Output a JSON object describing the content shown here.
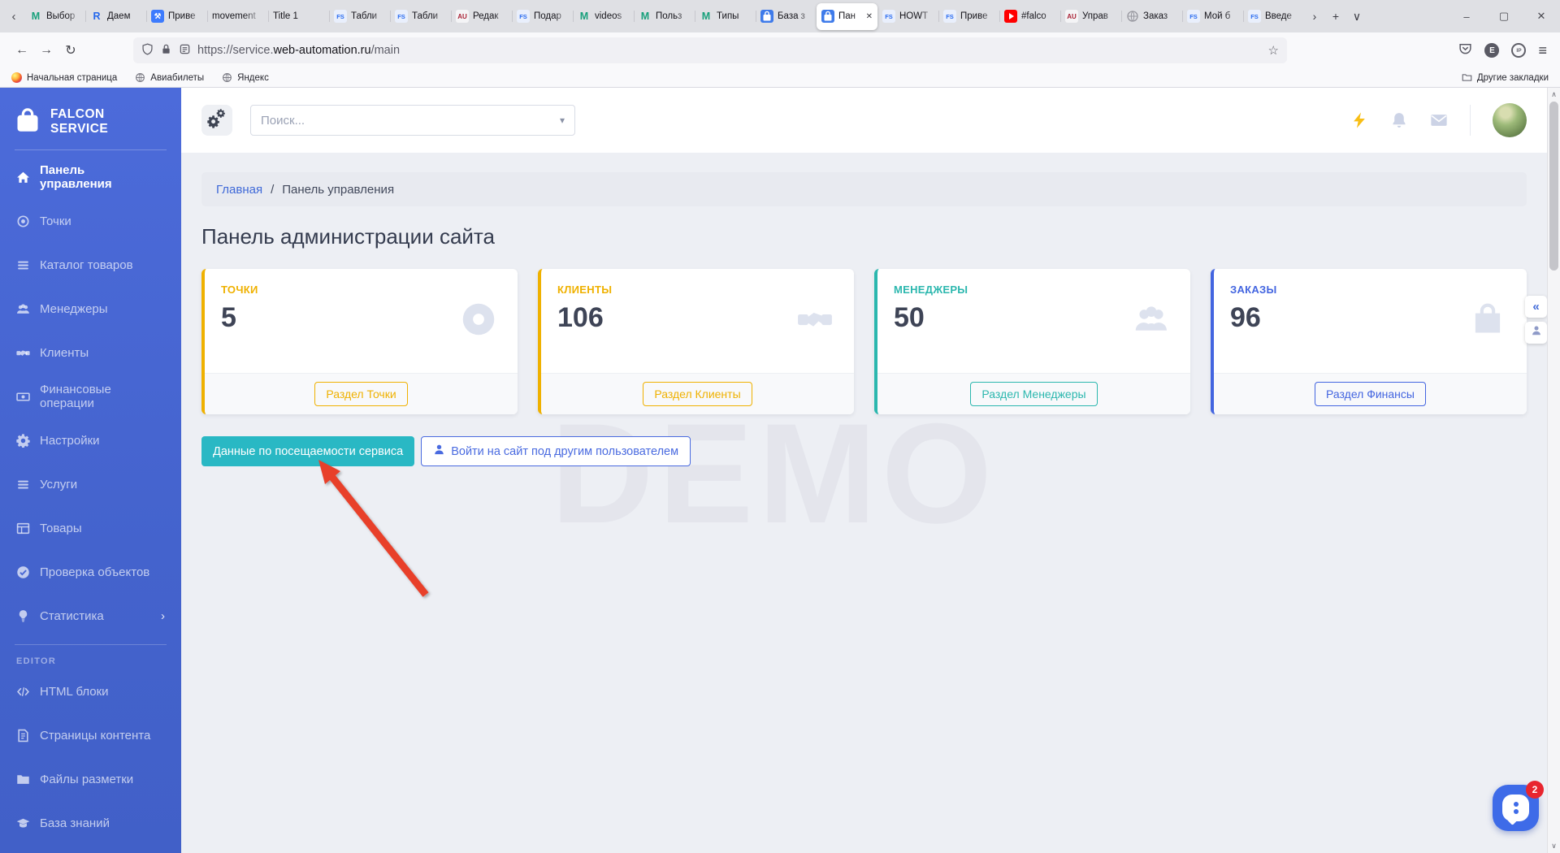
{
  "browser": {
    "tabs": [
      {
        "icon": "fav-m",
        "label": "Выбор"
      },
      {
        "icon": "fav-r",
        "label": "Даем"
      },
      {
        "icon": "fav-wrench",
        "label": "Приве"
      },
      {
        "icon": "",
        "label": "movement"
      },
      {
        "icon": "",
        "label": "Title 1"
      },
      {
        "icon": "fav-fs",
        "label": "Табли"
      },
      {
        "icon": "fav-fs",
        "label": "Табли"
      },
      {
        "icon": "fav-au",
        "label": "Редак"
      },
      {
        "icon": "fav-fs",
        "label": "Подар"
      },
      {
        "icon": "fav-m",
        "label": "videos"
      },
      {
        "icon": "fav-m",
        "label": "Польз"
      },
      {
        "icon": "fav-m",
        "label": "Типы"
      },
      {
        "icon": "fav-bag",
        "label": "База з"
      },
      {
        "icon": "fav-bag",
        "label": "Пан",
        "active": true
      },
      {
        "icon": "fav-fs",
        "label": "HOWT"
      },
      {
        "icon": "fav-fs",
        "label": "Приве"
      },
      {
        "icon": "fav-yt",
        "label": "#falco"
      },
      {
        "icon": "fav-au",
        "label": "Управ"
      },
      {
        "icon": "fav-globe",
        "label": "Заказ"
      },
      {
        "icon": "fav-fs",
        "label": "Мой б"
      },
      {
        "icon": "fav-fs",
        "label": "Введе"
      }
    ],
    "url": {
      "prefix": "https://service.",
      "domain": "web-automation.ru",
      "path": "/main"
    },
    "bookmarks": [
      {
        "icon": "firefox",
        "label": "Начальная страница"
      },
      {
        "icon": "globe",
        "label": "Авиабилеты"
      },
      {
        "icon": "globe",
        "label": "Яндекс"
      }
    ],
    "other_bookmarks": "Другие закладки",
    "extension_badge": "E",
    "ip_badge": "IP"
  },
  "glyphs": {
    "tab_scroll_left": "‹",
    "tab_overflow": "›",
    "new_tab": "+",
    "tabs_menu": "∨",
    "tab_close": "✕",
    "back": "←",
    "forward": "→",
    "reload": "↻",
    "bookmark_star": "☆",
    "menu": "≡",
    "minimize": "–",
    "maximize": "▢",
    "close": "✕",
    "caret_down": "▾",
    "collapse": "«",
    "scroll_up": "∧",
    "scroll_down": "∨"
  },
  "sidebar": {
    "brand": "FALCON SERVICE",
    "items": [
      {
        "icon": "home",
        "label": "Панель управления",
        "active": true
      },
      {
        "icon": "target",
        "label": "Точки"
      },
      {
        "icon": "list",
        "label": "Каталог товаров"
      },
      {
        "icon": "users",
        "label": "Менеджеры"
      },
      {
        "icon": "handshake",
        "label": "Клиенты"
      },
      {
        "icon": "cash",
        "label": "Финансовые операции"
      },
      {
        "icon": "gear",
        "label": "Настройки"
      },
      {
        "icon": "list",
        "label": "Услуги"
      },
      {
        "icon": "table",
        "label": "Товары"
      },
      {
        "icon": "check",
        "label": "Проверка объектов"
      },
      {
        "icon": "bulb",
        "label": "Статистика",
        "chevron": "›"
      }
    ],
    "section_label": "EDITOR",
    "editor_items": [
      {
        "icon": "code",
        "label": "HTML блоки"
      },
      {
        "icon": "page",
        "label": "Страницы контента"
      },
      {
        "icon": "folderw",
        "label": "Файлы разметки"
      },
      {
        "icon": "grad",
        "label": "База знаний"
      }
    ]
  },
  "header": {
    "search_placeholder": "Поиск..."
  },
  "breadcrumb": {
    "home": "Главная",
    "separator": "/",
    "current": "Панель управления"
  },
  "page": {
    "title": "Панель администрации сайта",
    "watermark": "DEMO"
  },
  "cards": [
    {
      "label": "ТОЧКИ",
      "value": "5",
      "icon": "record",
      "button": "Раздел Точки",
      "color": "#efb100"
    },
    {
      "label": "КЛИЕНТЫ",
      "value": "106",
      "icon": "handshake",
      "button": "Раздел Клиенты",
      "color": "#efb100"
    },
    {
      "label": "МЕНЕДЖЕРЫ",
      "value": "50",
      "icon": "users",
      "button": "Раздел Менеджеры",
      "color": "#2bb7ae"
    },
    {
      "label": "ЗАКАЗЫ",
      "value": "96",
      "icon": "bag",
      "button": "Раздел Финансы",
      "color": "#4365e0"
    }
  ],
  "actions": {
    "primary": "Данные по посещаемости сервиса",
    "secondary": "Войти на сайт под другим пользователем"
  },
  "chat": {
    "badge": "2"
  }
}
